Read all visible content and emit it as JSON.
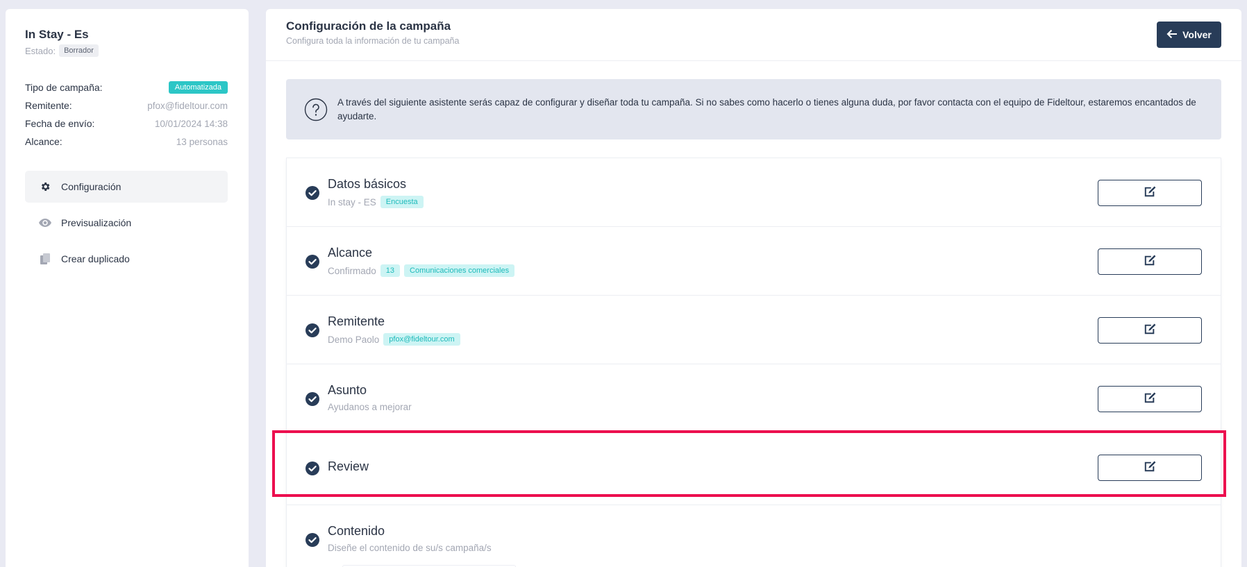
{
  "sidebar": {
    "campaign_title": "In Stay - Es",
    "estado_label": "Estado:",
    "estado_value": "Borrador",
    "info": [
      {
        "label": "Tipo de campaña:",
        "value": "Automatizada"
      },
      {
        "label": "Remitente:",
        "value": "pfox@fideltour.com"
      },
      {
        "label": "Fecha de envío:",
        "value": "10/01/2024 14:38"
      },
      {
        "label": "Alcance:",
        "value": "13 personas"
      }
    ],
    "menu": [
      {
        "label": "Configuración",
        "icon": "gear-icon"
      },
      {
        "label": "Previsualización",
        "icon": "eye-icon"
      },
      {
        "label": "Crear duplicado",
        "icon": "copy-icon"
      }
    ]
  },
  "main": {
    "title": "Configuración de la campaña",
    "subtitle": "Configura toda la información de tu campaña",
    "back_label": "Volver",
    "notice": "A través del siguiente asistente serás capaz de configurar y diseñar toda tu campaña. Si no sabes como hacerlo o tienes alguna duda, por favor contacta con el equipo de Fideltour, estaremos encantados de ayudarte.",
    "steps": [
      {
        "title": "Datos básicos",
        "subtitle": "In stay - ES",
        "tags": [
          "Encuesta"
        ]
      },
      {
        "title": "Alcance",
        "subtitle": "Confirmado",
        "tags": [
          "13",
          "Comunicaciones comerciales"
        ]
      },
      {
        "title": "Remitente",
        "subtitle": "Demo Paolo",
        "tags": [
          "pfox@fideltour.com"
        ]
      },
      {
        "title": "Asunto",
        "subtitle": "Ayudanos a mejorar",
        "tags": []
      },
      {
        "title": "Review",
        "subtitle": "",
        "tags": []
      },
      {
        "title": "Contenido",
        "subtitle": "Diseñe el contenido de su/s campaña/s",
        "tags": []
      }
    ]
  },
  "colors": {
    "primary": "#283c58",
    "accent": "#2cc6c6",
    "highlight": "#ec0f4f",
    "background": "#e9eaf3"
  }
}
